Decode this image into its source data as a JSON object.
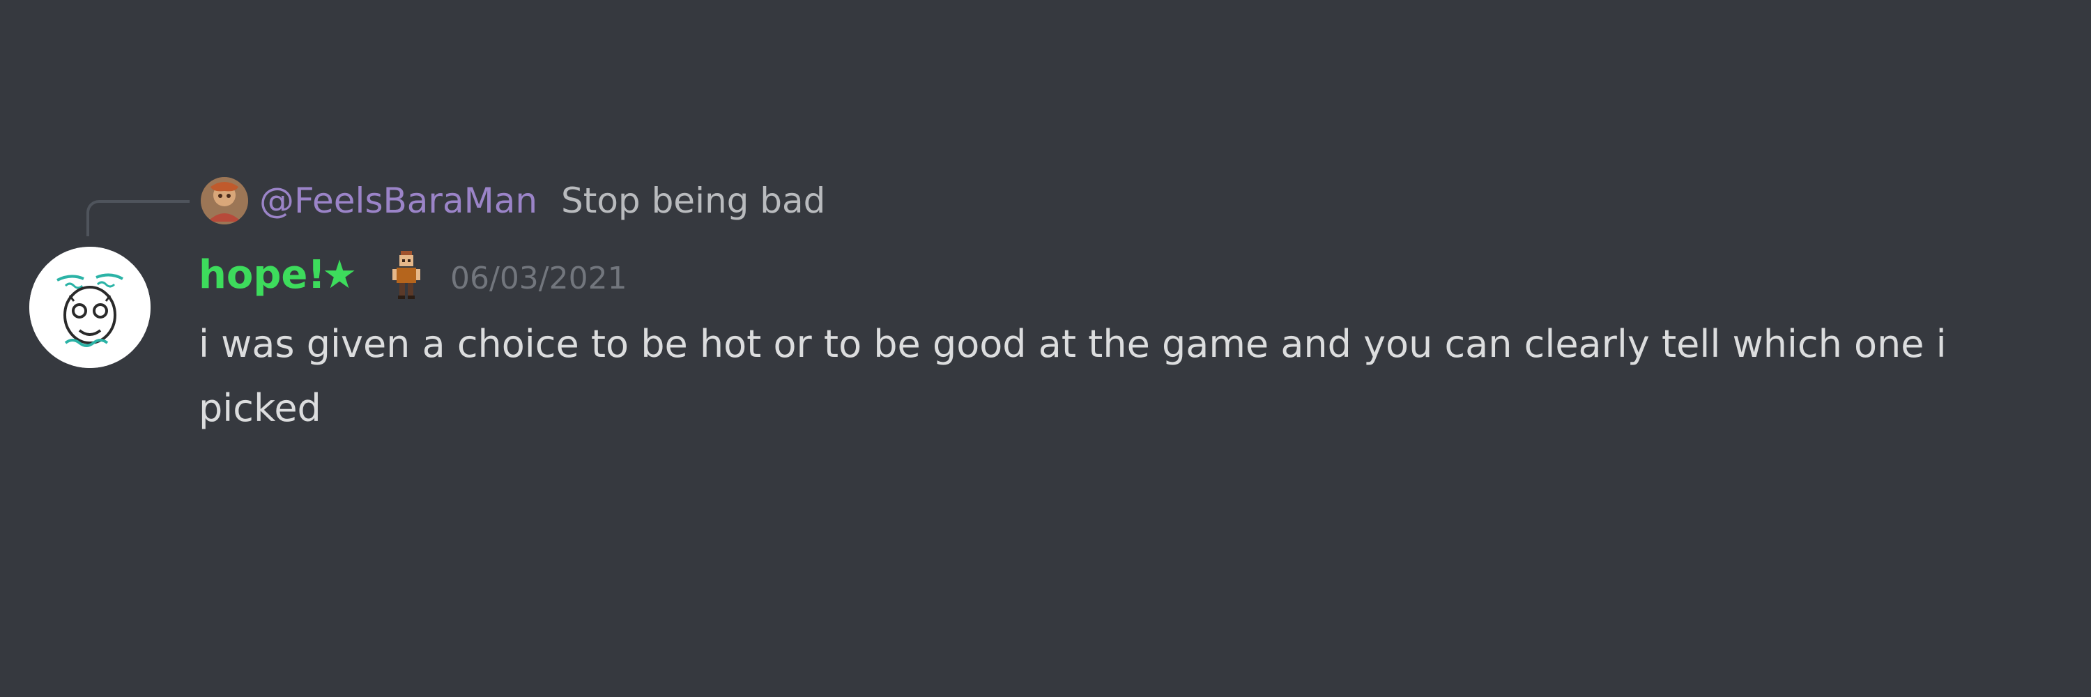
{
  "reply": {
    "author": "@FeelsBaraMan",
    "text": "Stop being bad",
    "author_color": "#9b84c8"
  },
  "message": {
    "username": "hope!",
    "username_color": "#3ddc5c",
    "badge_icon": "star-icon",
    "badge_glyph": "★",
    "role_icon": "pixel-character-icon",
    "timestamp": "06/03/2021",
    "content": "i was given a choice to be hot or to be good at the game and you can clearly tell which one i picked"
  },
  "theme": {
    "background": "#36393f",
    "text": "#dcddde",
    "muted": "#72767d"
  }
}
